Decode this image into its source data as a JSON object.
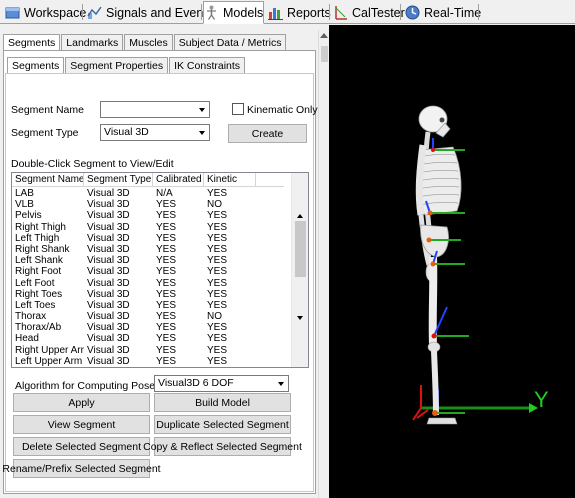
{
  "top_tabs": [
    {
      "label": "Workspace",
      "icon": "workspace-icon"
    },
    {
      "label": "Signals and Events",
      "icon": "signals-icon"
    },
    {
      "label": "Models",
      "icon": "skeleton-icon"
    },
    {
      "label": "Reports",
      "icon": "bar-chart-icon"
    },
    {
      "label": "CalTester",
      "icon": "caltester-icon"
    },
    {
      "label": "Real-Time",
      "icon": "realtime-icon"
    }
  ],
  "active_top_tab": "Models",
  "left": {
    "tabs": [
      "Segments",
      "Landmarks",
      "Muscles",
      "Subject Data / Metrics"
    ],
    "subtabs": [
      "Segments",
      "Segment Properties",
      "IK Constraints"
    ],
    "segment_name_label": "Segment Name",
    "segment_name_value": "",
    "kinematic_only_label": "Kinematic Only",
    "kinematic_only_checked": false,
    "segment_type_label": "Segment Type",
    "segment_type_value": "Visual 3D",
    "create_label": "Create",
    "list_label": "Double-Click Segment to View/Edit",
    "columns": [
      "Segment Name",
      "Segment Type",
      "Calibrated",
      "Kinetic"
    ],
    "rows": [
      [
        "LAB",
        "Visual 3D",
        "N/A",
        "YES"
      ],
      [
        "VLB",
        "Visual 3D",
        "YES",
        "NO"
      ],
      [
        "Pelvis",
        "Visual 3D",
        "YES",
        "YES"
      ],
      [
        "Right Thigh",
        "Visual 3D",
        "YES",
        "YES"
      ],
      [
        "Left Thigh",
        "Visual 3D",
        "YES",
        "YES"
      ],
      [
        "Right Shank",
        "Visual 3D",
        "YES",
        "YES"
      ],
      [
        "Left Shank",
        "Visual 3D",
        "YES",
        "YES"
      ],
      [
        "Right Foot",
        "Visual 3D",
        "YES",
        "YES"
      ],
      [
        "Left Foot",
        "Visual 3D",
        "YES",
        "YES"
      ],
      [
        "Right Toes",
        "Visual 3D",
        "YES",
        "YES"
      ],
      [
        "Left Toes",
        "Visual 3D",
        "YES",
        "YES"
      ],
      [
        "Thorax",
        "Visual 3D",
        "YES",
        "NO"
      ],
      [
        "Thorax/Ab",
        "Visual 3D",
        "YES",
        "YES"
      ],
      [
        "Head",
        "Visual 3D",
        "YES",
        "YES"
      ],
      [
        "Right Upper Arm",
        "Visual 3D",
        "YES",
        "YES"
      ],
      [
        "Left Upper Arm",
        "Visual 3D",
        "YES",
        "YES"
      ]
    ],
    "algorithm_label": "Algorithm for Computing Pose",
    "algorithm_value": "Visual3D 6 DOF",
    "buttons": {
      "apply": "Apply",
      "build_model": "Build Model",
      "view_segment": "View Segment",
      "duplicate_segment": "Duplicate Selected Segment",
      "delete_segment": "Delete Selected Segment",
      "copy_reflect": "Copy & Reflect Selected Segment",
      "rename_prefix": "Rename/Prefix Selected Segment"
    }
  },
  "viewport": {
    "axis_y_label": "Y",
    "axis_colors": {
      "x": "#1a8c1a",
      "y": "#22cc22",
      "z": "#2244ff",
      "red": "#e01010"
    },
    "background": "#000000"
  }
}
